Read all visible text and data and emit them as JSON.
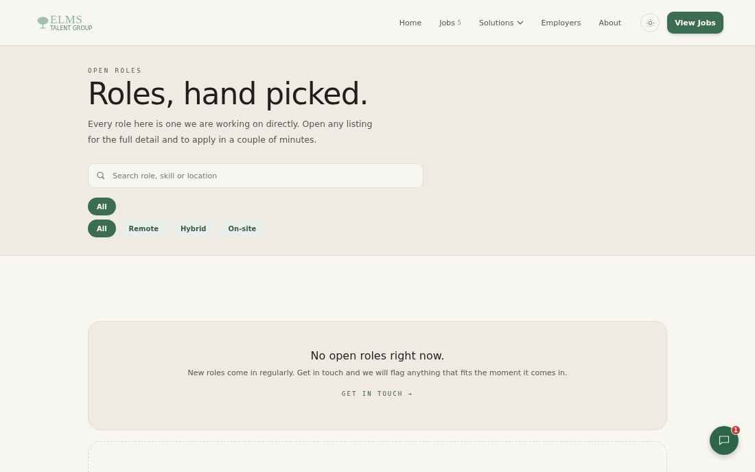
{
  "header": {
    "logo": {
      "name": "ELMS",
      "tagline": "TALENT GROUP"
    },
    "nav": [
      {
        "label": "Home",
        "selected": false
      },
      {
        "label": "Jobs",
        "count": "5",
        "selected": false
      },
      {
        "label": "Solutions",
        "dropdown": true,
        "selected": false
      },
      {
        "label": "Employers",
        "selected": false
      },
      {
        "label": "About",
        "selected": false
      }
    ],
    "cta": "View Jobs"
  },
  "hero": {
    "eyebrow": "OPEN ROLES",
    "title": "Roles, hand picked.",
    "intro": "Every role here is one we are working on directly. Open any listing for the full detail and to apply in a couple of minutes.",
    "search": {
      "placeholder": "Search role, skill or location"
    },
    "filter_rows": [
      {
        "chips": [
          {
            "label": "All",
            "selected": true
          }
        ]
      },
      {
        "chips": [
          {
            "label": "All",
            "selected": true
          },
          {
            "label": "Remote",
            "selected": false
          },
          {
            "label": "Hybrid",
            "selected": false
          },
          {
            "label": "On-site",
            "selected": false
          }
        ]
      }
    ]
  },
  "empty_state": {
    "title": "No open roles right now.",
    "message": "New roles come in regularly. Get in touch and we will flag anything that fits the moment it comes in.",
    "link": "GET IN TOUCH →"
  },
  "chat": {
    "badge": "1"
  }
}
